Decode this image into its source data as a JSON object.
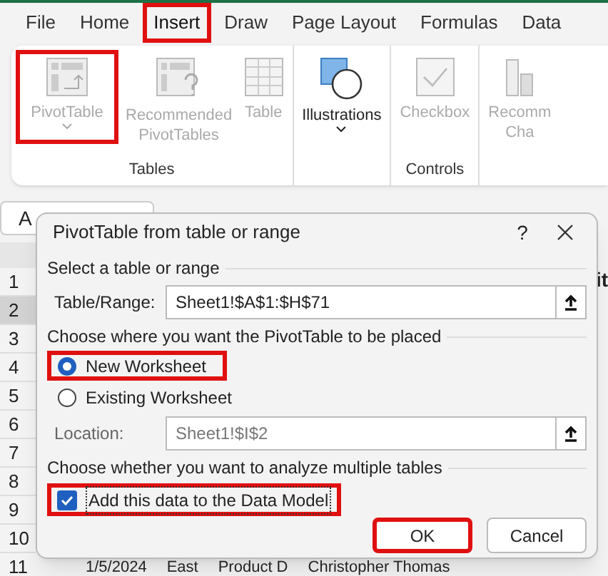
{
  "menu_tabs": [
    {
      "label": "File",
      "selected": false,
      "highlighted": false
    },
    {
      "label": "Home",
      "selected": false,
      "highlighted": false
    },
    {
      "label": "Insert",
      "selected": true,
      "highlighted": true
    },
    {
      "label": "Draw",
      "selected": false,
      "highlighted": false
    },
    {
      "label": "Page Layout",
      "selected": false,
      "highlighted": false
    },
    {
      "label": "Formulas",
      "selected": false,
      "highlighted": false
    },
    {
      "label": "Data",
      "selected": false,
      "highlighted": false
    }
  ],
  "ribbon": {
    "groups": [
      {
        "label": "Tables",
        "buttons": [
          {
            "kind": "pivot",
            "label": "PivotTable",
            "dropdown": true,
            "disabled": true,
            "highlighted": true
          },
          {
            "kind": "recommended",
            "label": "Recommended PivotTables",
            "dropdown": false,
            "disabled": true,
            "highlighted": false
          },
          {
            "kind": "table",
            "label": "Table",
            "dropdown": false,
            "disabled": true,
            "highlighted": false
          }
        ]
      },
      {
        "buttons": [
          {
            "kind": "shapes",
            "label": "Illustrations",
            "dropdown": true,
            "disabled": false,
            "highlighted": false
          }
        ]
      },
      {
        "label": "Controls",
        "buttons": [
          {
            "kind": "checkbox",
            "label": "Checkbox",
            "dropdown": false,
            "disabled": true,
            "highlighted": false
          }
        ]
      },
      {
        "buttons": [
          {
            "kind": "chart",
            "label": "Recomm Cha",
            "dropdown": false,
            "disabled": true,
            "highlighted": false
          }
        ]
      }
    ]
  },
  "name_box": "A",
  "sheet": {
    "row_numbers": [
      {
        "label": "1",
        "selected": false
      },
      {
        "label": "2",
        "selected": true
      },
      {
        "label": "3",
        "selected": false
      },
      {
        "label": "4",
        "selected": false
      },
      {
        "label": "5",
        "selected": false
      },
      {
        "label": "6",
        "selected": false
      },
      {
        "label": "7",
        "selected": false
      },
      {
        "label": "8",
        "selected": false
      },
      {
        "label": "9",
        "selected": false
      },
      {
        "label": "10",
        "selected": false
      },
      {
        "label": "11",
        "selected": false
      }
    ],
    "header_cell_fragment": "it",
    "row_11_cells": [
      "1/5/2024",
      "East",
      "Product D",
      "Christopher Thomas"
    ]
  },
  "dialog": {
    "title": "PivotTable from table or range",
    "help": "?",
    "section_1": "Select a table or range",
    "range_field": {
      "label": "Table/Range:",
      "value": "Sheet1!$A$1:$H$71"
    },
    "section_2": "Choose where you want the PivotTable to be placed",
    "placement_options": [
      {
        "label": "New Worksheet",
        "selected": true,
        "highlighted": true
      },
      {
        "label": "Existing Worksheet",
        "selected": false,
        "highlighted": false
      }
    ],
    "location_field": {
      "label": "Location:",
      "value": "Sheet1!$I$2",
      "disabled": true
    },
    "section_3": "Choose whether you want to analyze multiple tables",
    "data_model_checkbox": {
      "label": "Add this data to the Data Model",
      "checked": true,
      "highlighted": true
    },
    "buttons": [
      {
        "label": "OK",
        "highlighted": true
      },
      {
        "label": "Cancel",
        "highlighted": false
      }
    ]
  }
}
